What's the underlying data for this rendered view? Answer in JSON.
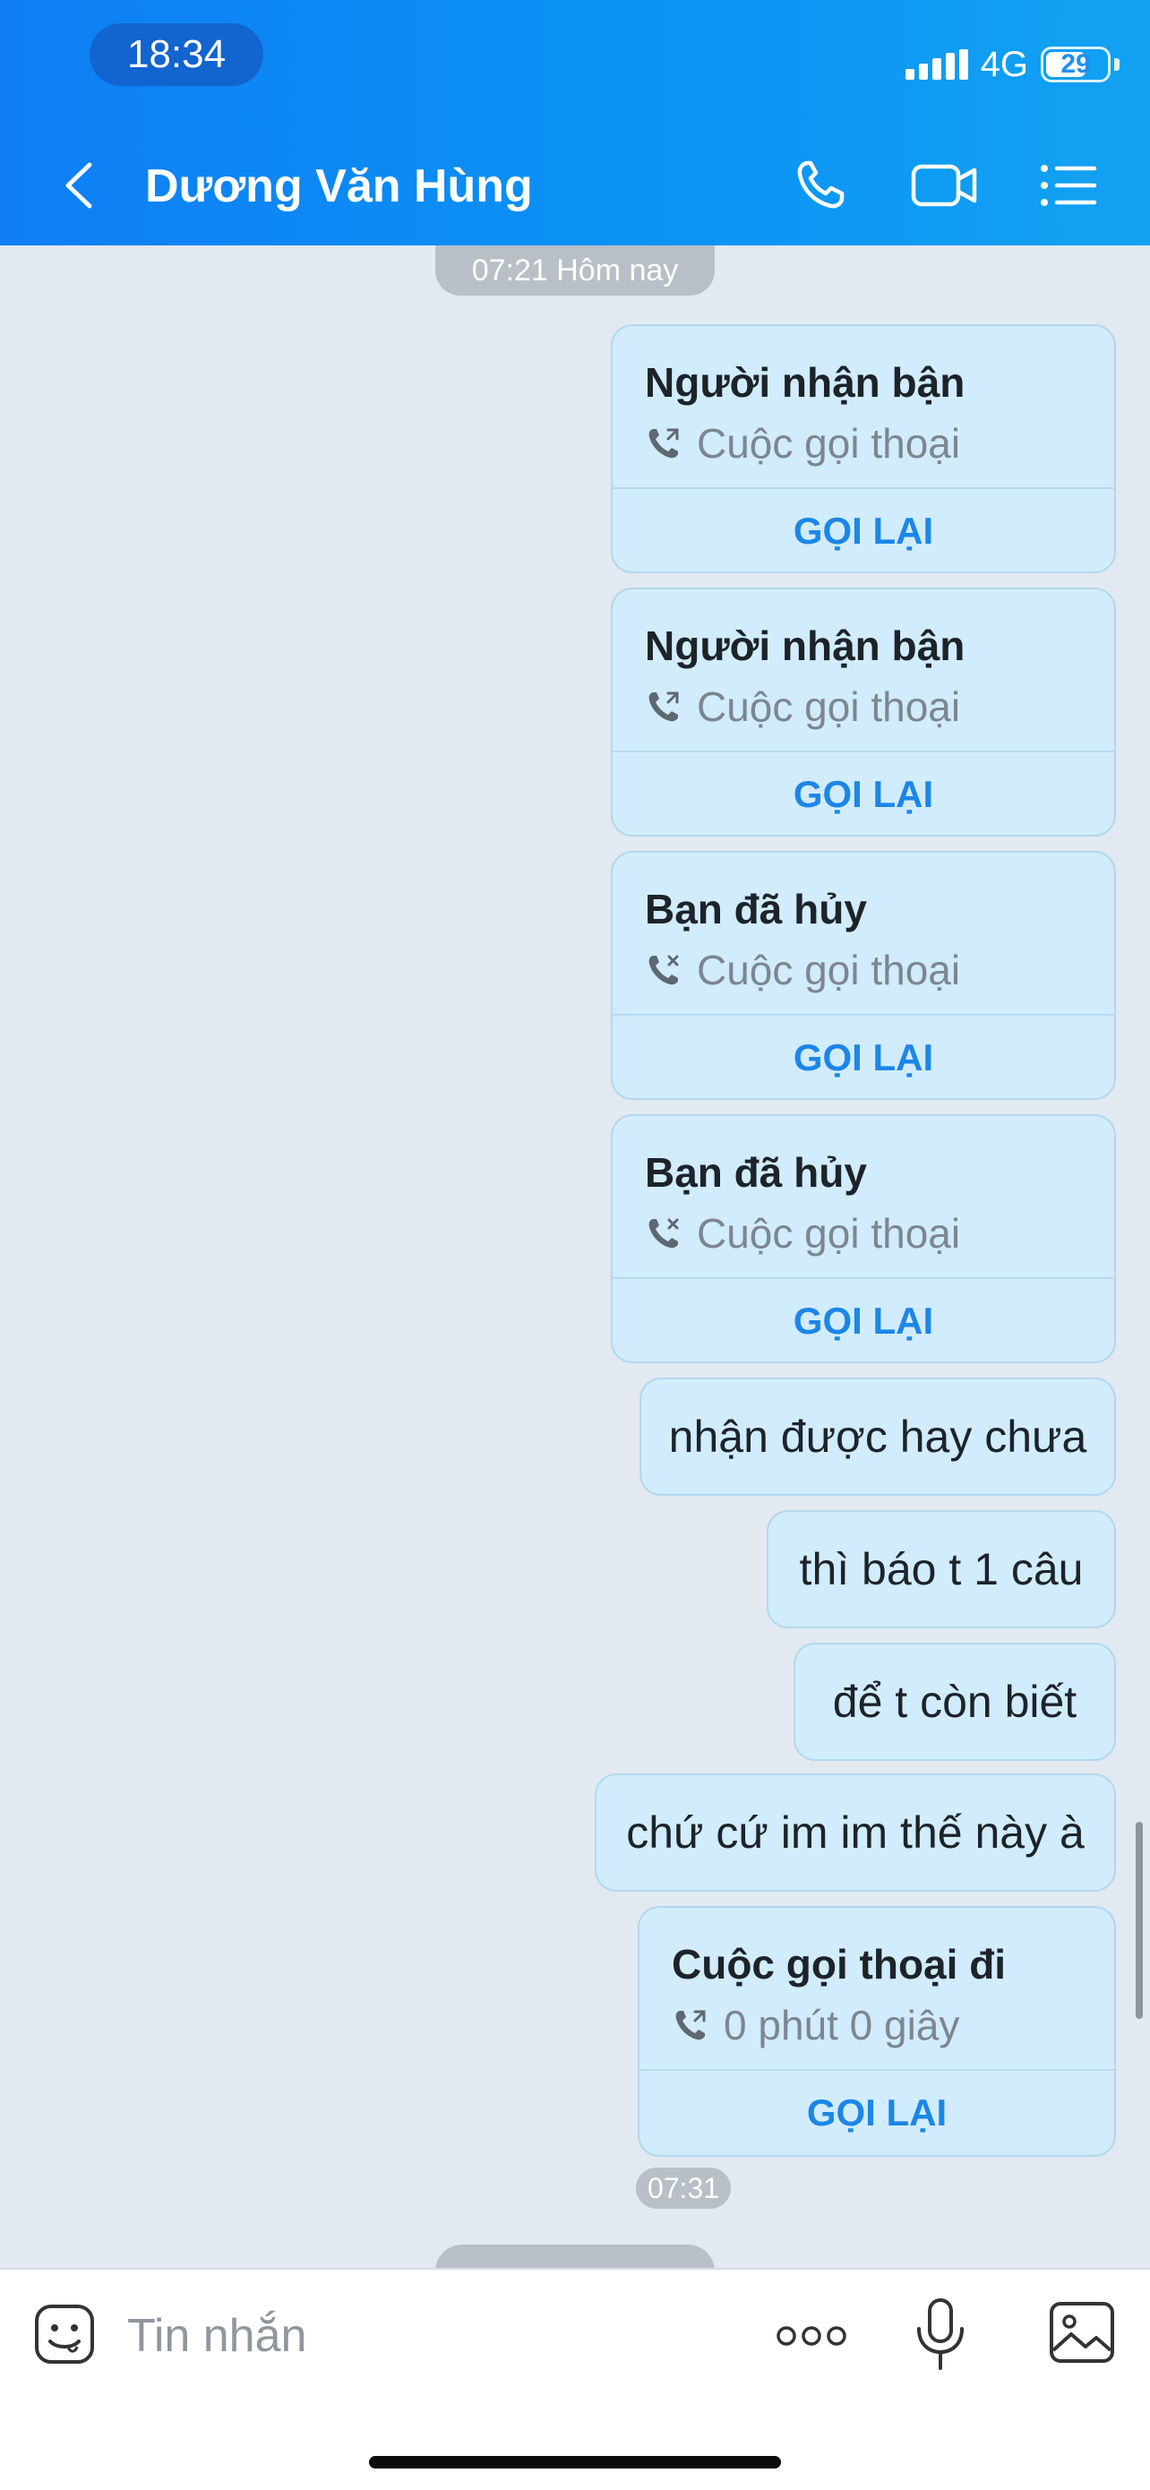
{
  "status_bar": {
    "time": "18:34",
    "network": "4G",
    "battery": "29",
    "battery_fraction": 0.29
  },
  "header": {
    "title": "Dương Văn Hùng"
  },
  "chat": {
    "top_timestamp": "07:21 Hôm nay",
    "messages": [
      {
        "type": "call",
        "title": "Người nhận bận",
        "subtitle": "Cuộc gọi thoại",
        "action": "GỌI LẠI",
        "icon": "phone-outgoing-icon"
      },
      {
        "type": "call",
        "title": "Người nhận bận",
        "subtitle": "Cuộc gọi thoại",
        "action": "GỌI LẠI",
        "icon": "phone-outgoing-icon"
      },
      {
        "type": "call",
        "title": "Bạn đã hủy",
        "subtitle": "Cuộc gọi thoại",
        "action": "GỌI LẠI",
        "icon": "phone-cancelled-icon"
      },
      {
        "type": "call",
        "title": "Bạn đã hủy",
        "subtitle": "Cuộc gọi thoại",
        "action": "GỌI LẠI",
        "icon": "phone-cancelled-icon"
      },
      {
        "type": "text",
        "text": "nhận được hay chưa"
      },
      {
        "type": "text",
        "text": "thì báo t 1 câu"
      },
      {
        "type": "text",
        "text": "để t còn biết"
      },
      {
        "type": "text",
        "text": "chứ cứ im im thế này à"
      },
      {
        "type": "call",
        "title": "Cuộc gọi thoại đi",
        "subtitle": "0 phút 0 giây",
        "action": "GỌI LẠI",
        "icon": "phone-outgoing-icon"
      }
    ],
    "last_time": "07:31"
  },
  "composer": {
    "placeholder": "Tin nhắn"
  },
  "colors": {
    "header": "#0a8ff4",
    "bubble": "#d1ecfc",
    "action": "#1c86e8",
    "chat_bg": "#e2e9f1"
  }
}
